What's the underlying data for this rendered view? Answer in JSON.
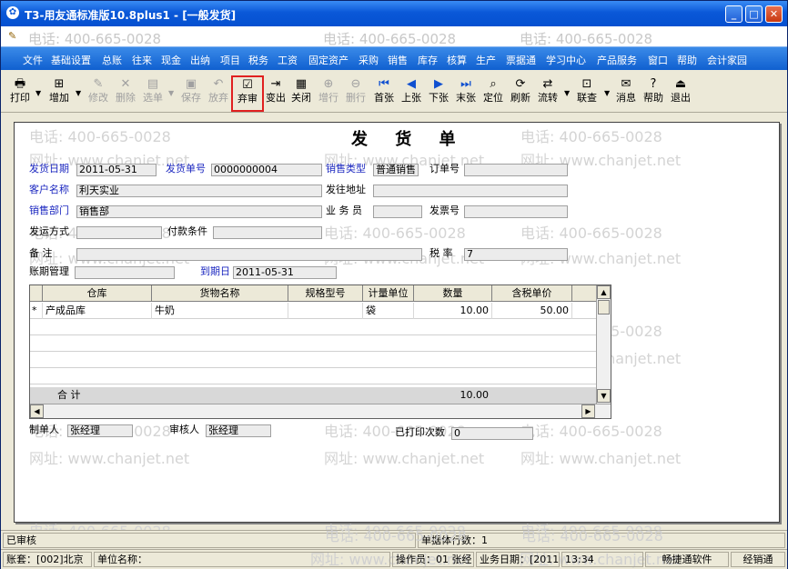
{
  "window": {
    "title": "T3-用友通标准版10.8plus1 - [一般发货]"
  },
  "watermark": {
    "phone": "电话: 400-665-0028",
    "site": "网址: www.chanjet.net"
  },
  "menu": [
    "文件",
    "基础设置",
    "总账",
    "往来",
    "现金",
    "出纳",
    "项目",
    "税务",
    "工资",
    "固定资产",
    "采购",
    "销售",
    "库存",
    "核算",
    "生产",
    "票据通",
    "学习中心",
    "产品服务",
    "窗口",
    "帮助",
    "会计家园"
  ],
  "toolbar": {
    "print": "打印",
    "add": "增加",
    "modify": "修改",
    "delete": "删除",
    "select_order": "选单",
    "save": "保存",
    "abandon": "放弃",
    "unaudit": "弃审",
    "change": "变出",
    "close": "关闭",
    "add_row": "增行",
    "del_row": "删行",
    "first": "首张",
    "prev": "上张",
    "next": "下张",
    "last": "末张",
    "locate": "定位",
    "refresh": "刷新",
    "flow": "流转",
    "query": "联查",
    "message": "消息",
    "help": "帮助",
    "exit": "退出"
  },
  "form": {
    "title": "发 货 单",
    "ship_date_label": "发货日期",
    "ship_date": "2011-05-31",
    "ship_no_label": "发货单号",
    "ship_no": "0000000004",
    "sale_type_label": "销售类型",
    "sale_type": "普通销售",
    "order_no_label": "订单号",
    "order_no": "",
    "customer_label": "客户名称",
    "customer": "利天实业",
    "ship_addr_label": "发往地址",
    "ship_addr": "",
    "dept_label": "销售部门",
    "dept": "销售部",
    "salesman_label": "业 务 员",
    "salesman": "",
    "invoice_no_label": "发票号",
    "invoice_no": "",
    "ship_method_label": "发运方式",
    "ship_method": "",
    "payment_label": "付款条件",
    "payment": "",
    "remark_label": "备    注",
    "remark": "",
    "tax_label": "税    率",
    "tax": "7",
    "credit_label": "账期管理",
    "credit": "",
    "due_label": "到期日",
    "due": "2011-05-31",
    "maker_label": "制单人",
    "maker": "张经理",
    "auditor_label": "审核人",
    "auditor": "张经理",
    "print_count_label": "已打印次数",
    "print_count": "0"
  },
  "grid": {
    "headers": [
      "仓库",
      "货物名称",
      "规格型号",
      "计量单位",
      "数量",
      "含税单价"
    ],
    "rows": [
      {
        "marker": "*",
        "warehouse": "产成品库",
        "goods": "牛奶",
        "spec": "",
        "unit": "袋",
        "qty": "10.00",
        "price": "50.00"
      }
    ],
    "sum_label": "合  计",
    "sum_qty": "10.00"
  },
  "status": {
    "audit": "已审核",
    "rows": "单据体行数：1",
    "account": "账套：[002]北京",
    "unit": "单位名称：",
    "operator": "操作员：01 张经",
    "bizdate": "业务日期：[2011",
    "time": "13:34",
    "soft": "畅捷通软件",
    "product": "经销通"
  }
}
